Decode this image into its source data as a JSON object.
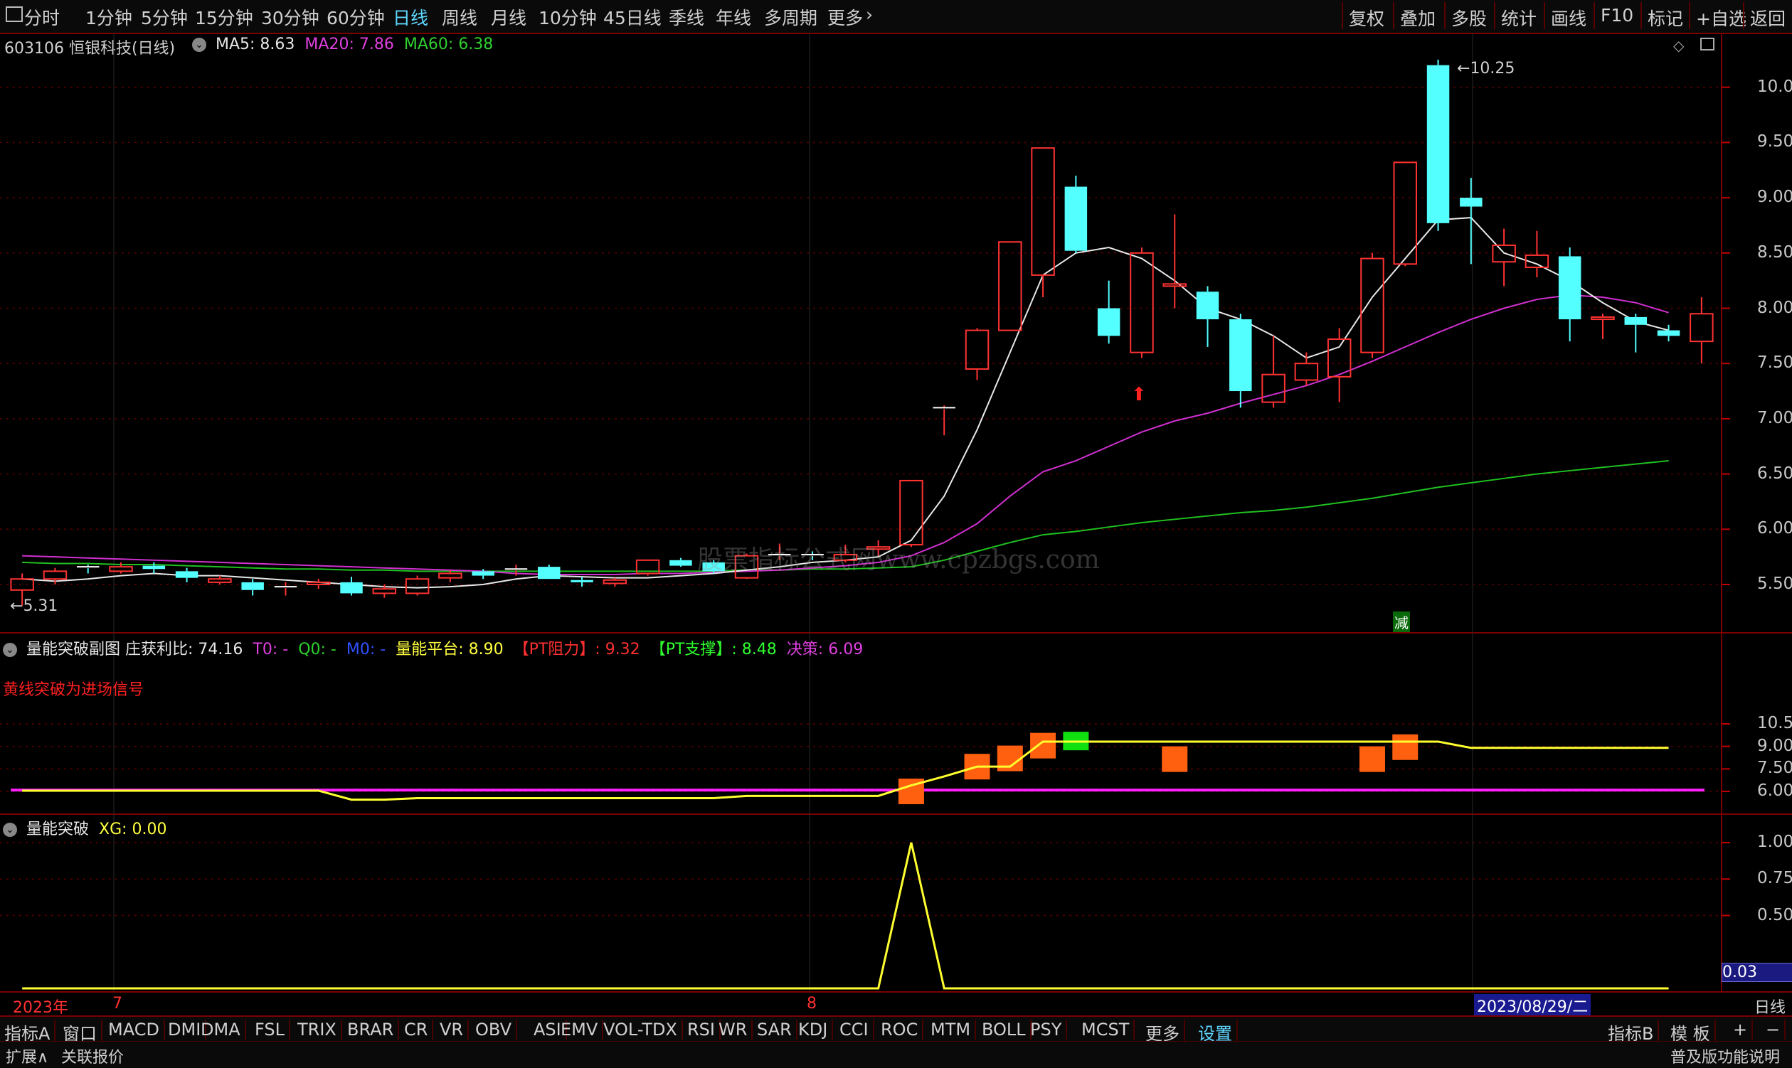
{
  "top_tabs": [
    {
      "label": "分时",
      "active": false
    },
    {
      "label": "1分钟",
      "active": false
    },
    {
      "label": "5分钟",
      "active": false
    },
    {
      "label": "15分钟",
      "active": false
    },
    {
      "label": "30分钟",
      "active": false
    },
    {
      "label": "60分钟",
      "active": false
    },
    {
      "label": "日线",
      "active": true
    },
    {
      "label": "周线",
      "active": false
    },
    {
      "label": "月线",
      "active": false
    },
    {
      "label": "10分钟",
      "active": false
    },
    {
      "label": "45日线",
      "active": false
    },
    {
      "label": "季线",
      "active": false
    },
    {
      "label": "年线",
      "active": false
    },
    {
      "label": "多周期",
      "active": false
    },
    {
      "label": "更多",
      "active": false
    }
  ],
  "right_tools": [
    "复权",
    "叠加",
    "多股",
    "统计",
    "画线",
    "F10",
    "标记",
    "+自选",
    "返回"
  ],
  "main_header": {
    "code_name": "603106 恒银科技(日线)",
    "ma5": "MA5: 8.63",
    "ma20": "MA20: 7.86",
    "ma60": "MA60: 6.38"
  },
  "main_annotations": {
    "high": "10.25",
    "low": "5.31",
    "reduce": "减",
    "watermark": "股票指标公式网www.cpzbgs.com"
  },
  "main_axis": [
    "10.00",
    "9.50",
    "9.00",
    "8.50",
    "8.00",
    "7.50",
    "7.00",
    "6.50",
    "6.00",
    "5.50"
  ],
  "sub1_header": {
    "title": "量能突破副图",
    "zhuang": "庄获利比: 74.16",
    "t0": "T0: -",
    "q0": "Q0: -",
    "m0": "M0: -",
    "platform": "量能平台: 8.90",
    "pt_res": "【PT阻力】: 9.32",
    "pt_sup": "【PT支撑】: 8.48",
    "decision": "决策: 6.09"
  },
  "sub1_note": "黄线突破为进场信号",
  "sub1_axis": [
    "10.50",
    "9.00",
    "7.50",
    "6.00"
  ],
  "sub2_header": {
    "title": "量能突破",
    "xg": "XG: 0.00"
  },
  "sub2_axis": [
    "1.00",
    "0.75",
    "0.50"
  ],
  "sub2_current": "0.03",
  "date_axis": {
    "year": "2023年",
    "m7": "7",
    "m8": "8",
    "cursor_date": "2023/08/29/二",
    "period": "日线"
  },
  "bottom_tabs": [
    "指标A",
    "窗口",
    "MACD",
    "DMI",
    "DMA",
    "FSL",
    "TRIX",
    "BRAR",
    "CR",
    "VR",
    "OBV",
    "ASI",
    "EMV",
    "VOL-TDX",
    "RSI",
    "WR",
    "SAR",
    "KDJ",
    "CCI",
    "ROC",
    "MTM",
    "BOLL",
    "PSY",
    "MCST",
    "更多",
    "设置"
  ],
  "bottom_right": [
    "指标B",
    "模 板",
    "+",
    "−"
  ],
  "status": {
    "expand": "扩展∧",
    "related": "关联报价",
    "edition": "普及版功能说明"
  },
  "chart_data": {
    "type": "candlestick",
    "candles": [
      {
        "o": 5.45,
        "c": 5.55,
        "h": 5.6,
        "l": 5.31
      },
      {
        "o": 5.55,
        "c": 5.62,
        "h": 5.65,
        "l": 5.5
      },
      {
        "o": 5.66,
        "c": 5.65,
        "h": 5.68,
        "l": 5.6
      },
      {
        "o": 5.62,
        "c": 5.66,
        "h": 5.7,
        "l": 5.6
      },
      {
        "o": 5.67,
        "c": 5.64,
        "h": 5.7,
        "l": 5.6
      },
      {
        "o": 5.62,
        "c": 5.56,
        "h": 5.65,
        "l": 5.52
      },
      {
        "o": 5.52,
        "c": 5.55,
        "h": 5.58,
        "l": 5.5
      },
      {
        "o": 5.52,
        "c": 5.45,
        "h": 5.55,
        "l": 5.4
      },
      {
        "o": 5.48,
        "c": 5.48,
        "h": 5.52,
        "l": 5.4
      },
      {
        "o": 5.5,
        "c": 5.52,
        "h": 5.55,
        "l": 5.46
      },
      {
        "o": 5.52,
        "c": 5.42,
        "h": 5.57,
        "l": 5.4
      },
      {
        "o": 5.42,
        "c": 5.46,
        "h": 5.5,
        "l": 5.38
      },
      {
        "o": 5.42,
        "c": 5.55,
        "h": 5.58,
        "l": 5.4
      },
      {
        "o": 5.56,
        "c": 5.6,
        "h": 5.63,
        "l": 5.52
      },
      {
        "o": 5.62,
        "c": 5.58,
        "h": 5.64,
        "l": 5.55
      },
      {
        "o": 5.64,
        "c": 5.64,
        "h": 5.68,
        "l": 5.58
      },
      {
        "o": 5.66,
        "c": 5.55,
        "h": 5.68,
        "l": 5.55
      },
      {
        "o": 5.54,
        "c": 5.52,
        "h": 5.57,
        "l": 5.48
      },
      {
        "o": 5.51,
        "c": 5.54,
        "h": 5.56,
        "l": 5.48
      },
      {
        "o": 5.6,
        "c": 5.72,
        "h": 5.72,
        "l": 5.58
      },
      {
        "o": 5.72,
        "c": 5.67,
        "h": 5.74,
        "l": 5.66
      },
      {
        "o": 5.7,
        "c": 5.62,
        "h": 5.72,
        "l": 5.6
      },
      {
        "o": 5.56,
        "c": 5.76,
        "h": 5.78,
        "l": 5.55
      },
      {
        "o": 5.77,
        "c": 5.77,
        "h": 5.87,
        "l": 5.72
      },
      {
        "o": 5.77,
        "c": 5.76,
        "h": 5.8,
        "l": 5.72
      },
      {
        "o": 5.72,
        "c": 5.77,
        "h": 5.86,
        "l": 5.7
      },
      {
        "o": 5.82,
        "c": 5.84,
        "h": 5.9,
        "l": 5.76
      },
      {
        "o": 5.86,
        "c": 6.44,
        "h": 6.44,
        "l": 5.84
      },
      {
        "o": 7.1,
        "c": 7.1,
        "h": 7.12,
        "l": 6.85
      },
      {
        "o": 7.45,
        "c": 7.8,
        "h": 7.82,
        "l": 7.35
      },
      {
        "o": 7.8,
        "c": 8.6,
        "h": 8.6,
        "l": 7.8
      },
      {
        "o": 8.3,
        "c": 9.45,
        "h": 9.45,
        "l": 8.1
      },
      {
        "o": 9.1,
        "c": 8.52,
        "h": 9.2,
        "l": 8.5
      },
      {
        "o": 8.0,
        "c": 7.75,
        "h": 8.25,
        "l": 7.68
      },
      {
        "o": 7.6,
        "c": 8.5,
        "h": 8.55,
        "l": 7.55
      },
      {
        "o": 8.2,
        "c": 8.22,
        "h": 8.85,
        "l": 8.0
      },
      {
        "o": 8.15,
        "c": 7.9,
        "h": 8.2,
        "l": 7.65
      },
      {
        "o": 7.9,
        "c": 7.25,
        "h": 7.95,
        "l": 7.1
      },
      {
        "o": 7.15,
        "c": 7.4,
        "h": 7.75,
        "l": 7.1
      },
      {
        "o": 7.35,
        "c": 7.5,
        "h": 7.6,
        "l": 7.3
      },
      {
        "o": 7.38,
        "c": 7.72,
        "h": 7.82,
        "l": 7.15
      },
      {
        "o": 7.6,
        "c": 8.45,
        "h": 8.5,
        "l": 7.55
      },
      {
        "o": 8.4,
        "c": 9.32,
        "h": 9.32,
        "l": 8.38
      },
      {
        "o": 10.2,
        "c": 8.77,
        "h": 10.25,
        "l": 8.7
      },
      {
        "o": 9.0,
        "c": 8.92,
        "h": 9.18,
        "l": 8.4
      },
      {
        "o": 8.42,
        "c": 8.57,
        "h": 8.72,
        "l": 8.2
      },
      {
        "o": 8.37,
        "c": 8.48,
        "h": 8.7,
        "l": 8.28
      },
      {
        "o": 8.47,
        "c": 7.9,
        "h": 8.55,
        "l": 7.7
      },
      {
        "o": 7.9,
        "c": 7.92,
        "h": 7.95,
        "l": 7.72
      },
      {
        "o": 7.92,
        "c": 7.85,
        "h": 7.95,
        "l": 7.6
      },
      {
        "o": 7.8,
        "c": 7.75,
        "h": 7.85,
        "l": 7.7
      },
      {
        "o": 7.7,
        "c": 7.95,
        "h": 8.1,
        "l": 7.5
      }
    ],
    "ma5": [
      5.55,
      5.53,
      5.55,
      5.58,
      5.6,
      5.58,
      5.58,
      5.56,
      5.54,
      5.52,
      5.5,
      5.48,
      5.47,
      5.48,
      5.5,
      5.55,
      5.58,
      5.57,
      5.56,
      5.56,
      5.58,
      5.6,
      5.63,
      5.66,
      5.7,
      5.72,
      5.75,
      5.9,
      6.3,
      6.9,
      7.6,
      8.3,
      8.5,
      8.55,
      8.45,
      8.25,
      8.0,
      7.9,
      7.75,
      7.55,
      7.65,
      8.1,
      8.45,
      8.8,
      8.82,
      8.5,
      8.4,
      8.25,
      8.05,
      7.88,
      7.8
    ],
    "ma20": [
      5.76,
      5.75,
      5.74,
      5.73,
      5.72,
      5.71,
      5.7,
      5.69,
      5.68,
      5.67,
      5.66,
      5.65,
      5.64,
      5.63,
      5.62,
      5.6,
      5.59,
      5.59,
      5.59,
      5.6,
      5.6,
      5.61,
      5.62,
      5.63,
      5.65,
      5.67,
      5.7,
      5.76,
      5.88,
      6.05,
      6.3,
      6.52,
      6.62,
      6.75,
      6.88,
      6.98,
      7.05,
      7.14,
      7.22,
      7.3,
      7.4,
      7.52,
      7.65,
      7.78,
      7.9,
      8.0,
      8.08,
      8.12,
      8.1,
      8.05,
      7.96
    ],
    "ma60": [
      5.7,
      5.69,
      5.69,
      5.68,
      5.68,
      5.67,
      5.66,
      5.65,
      5.64,
      5.64,
      5.63,
      5.63,
      5.62,
      5.62,
      5.62,
      5.62,
      5.62,
      5.62,
      5.62,
      5.62,
      5.62,
      5.62,
      5.63,
      5.63,
      5.64,
      5.64,
      5.65,
      5.66,
      5.72,
      5.8,
      5.88,
      5.95,
      5.98,
      6.02,
      6.06,
      6.09,
      6.12,
      6.15,
      6.17,
      6.2,
      6.24,
      6.28,
      6.33,
      6.38,
      6.42,
      6.46,
      6.5,
      6.53,
      6.56,
      6.59,
      6.62
    ],
    "sub1_yellow": [
      6.05,
      6.05,
      6.05,
      6.05,
      6.05,
      6.05,
      6.05,
      6.05,
      6.05,
      6.05,
      5.45,
      5.45,
      5.55,
      5.55,
      5.55,
      5.55,
      5.55,
      5.55,
      5.55,
      5.55,
      5.55,
      5.55,
      5.7,
      5.7,
      5.7,
      5.7,
      5.7,
      6.4,
      7.0,
      7.65,
      7.65,
      9.32,
      9.32,
      9.32,
      9.32,
      9.32,
      9.32,
      9.32,
      9.32,
      9.32,
      9.32,
      9.32,
      9.32,
      9.32,
      8.9,
      8.9,
      8.9,
      8.9,
      8.9,
      8.9,
      8.9
    ],
    "sub1_magenta": 6.09,
    "sub2_xg": [
      0,
      0,
      0,
      0,
      0,
      0,
      0,
      0,
      0,
      0,
      0,
      0,
      0,
      0,
      0,
      0,
      0,
      0,
      0,
      0,
      0,
      0,
      0,
      0,
      0,
      0,
      0,
      1,
      0,
      0,
      0,
      0,
      0,
      0,
      0,
      0,
      0,
      0,
      0,
      0,
      0,
      0,
      0,
      0,
      0,
      0,
      0,
      0,
      0,
      0,
      0
    ]
  }
}
